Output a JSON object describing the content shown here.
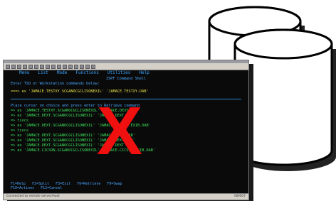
{
  "menu": {
    "items": [
      "Menu",
      "List",
      "Mode",
      "Functions",
      "Utilities",
      "Help"
    ]
  },
  "screen": {
    "heading": "ISPF Command Shell",
    "prompt": "Enter TSO or Workstation commands below:",
    "command_line": "===> ex 'JAMACE.TESTXY.SCGANOCGCLISONEXIL' 'JAMACE.TESTXY.DAB'",
    "instructions": "Place cursor on choice and press enter to Retrieve command",
    "history": [
      "=> ex 'JAMACE.TESTXY.SCGANOCGCLISONEXIL' 'JAMACE.DEXT.DAB'",
      "=> ex 'JAMACE.DEXT.SCGANOCGCLISONEXIL' 'JAMACE.DEXT.DAB'",
      "=> tsocs",
      "=> ex 'JAMACE.DEXT.SCGANOCGCLISONEXIL' 'JAMACE.CICSON.EXIB.DAB'",
      "=> tsocs",
      "=> ex 'JAMACE.DEXT.SCGANOCGCLISONEXIL' 'JAMACE.DEXT.DAB'",
      "=> ex 'JAMACE.DEXT.SCGANOCGCLISONEXIL' 'JAMACE.DEXT.DAB'",
      "=> ex 'JAMACE.DEXT.SCGANOCGCLISONEXIL' 'JAMACE.DEXT.DAB'",
      "=> ex 'JAMACE.CICSON.SCGANOCGCLISONEXIL' 'JAMACE.CICSON.EXIB.DAB'"
    ],
    "fkeys_row1": "F1=Help F2=Split F3=Exit F6=Retrieve F9=Swap",
    "fkeys_row2": "F10=Actions F12=Cancel"
  },
  "overlay": {
    "mark": "X"
  },
  "status": {
    "left": "Connected to remote server/host",
    "right": "08/007"
  },
  "colors": {
    "screen_bg": "#0a0a0a",
    "menu_text": "#3aa5ff",
    "x_mark": "#f01010",
    "cylinder_fill": "#ffffff",
    "cylinder_stroke": "#000000"
  }
}
